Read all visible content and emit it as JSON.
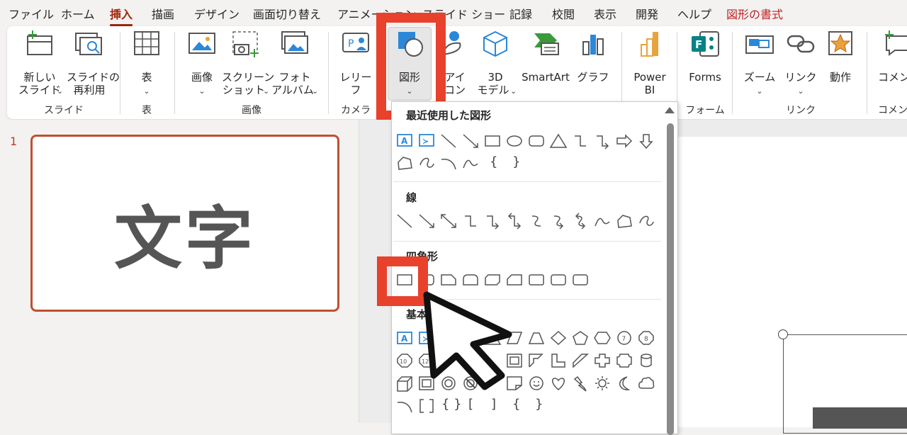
{
  "menu": {
    "tabs": [
      "ファイル",
      "ホーム",
      "挿入",
      "描画",
      "デザイン",
      "画面切り替え",
      "アニメーション",
      "スライド ショー",
      "記録",
      "校閲",
      "表示",
      "開発",
      "ヘルプ",
      "図形の書式"
    ],
    "active_tab": "挿入"
  },
  "ribbon": {
    "buttons": {
      "new_slide": [
        "新しい",
        "スライド"
      ],
      "reuse_slide": [
        "スライドの",
        "再利用"
      ],
      "table": "表",
      "image": "画像",
      "screenshot": [
        "スクリーン",
        "ショット"
      ],
      "photo_album": [
        "フォト",
        "アルバム"
      ],
      "cameo": [
        "レリー",
        "フ"
      ],
      "shapes": "図形",
      "icons": [
        "アイ",
        "コン"
      ],
      "model3d": [
        "3D",
        "モデル"
      ],
      "smartart": "SmartArt",
      "chart": "グラフ",
      "powerbi": [
        "Power",
        "BI"
      ],
      "forms": "Forms",
      "zoom": "ズーム",
      "link": "リンク",
      "action": "動作",
      "comment": "コメント"
    },
    "groups": {
      "slides": "スライド",
      "tables": "表",
      "images": "画像",
      "camera": "カメラ",
      "forms": "フォーム",
      "links": "リンク",
      "comments": "コメント"
    },
    "dropdown_glyph": "⌄"
  },
  "slide_panel": {
    "slide_number": "1",
    "slide_text": "文字"
  },
  "shape_gallery": {
    "sections": {
      "recent": "最近使用した図形",
      "lines": "線",
      "rectangles": "四角形",
      "basic": "基本図形"
    },
    "brace_text": [
      "{",
      "}",
      "{ }",
      "[",
      "]",
      "{",
      "}"
    ]
  },
  "colors": {
    "accent": "#a1260d",
    "highlight": "#e8412c",
    "thumb_border": "#c0502f",
    "icon_blue": "#2b88d8"
  }
}
